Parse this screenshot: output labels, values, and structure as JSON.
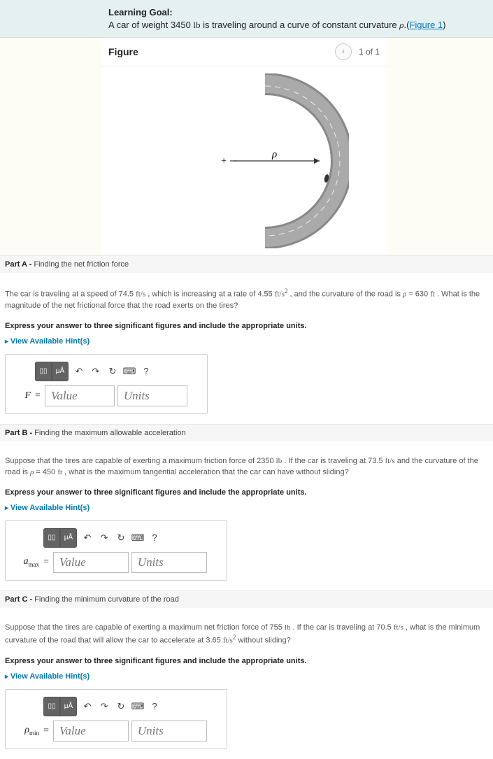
{
  "learning_goal": {
    "title": "Learning Goal:",
    "prefix": "A car of weight 3450 ",
    "unit1": "lb",
    "mid": " is traveling around a curve of constant curvature ",
    "rho": "ρ",
    "paren_open": ".(",
    "figure_link": "Figure 1",
    "paren_close": ")"
  },
  "figure": {
    "title": "Figure",
    "counter": "1 of 1",
    "rho_label": "ρ",
    "plus": "+"
  },
  "instruction": "Express your answer to three significant figures and include the appropriate units.",
  "hints": "View Available Hint(s)",
  "placeholders": {
    "value": "Value",
    "units": "Units"
  },
  "partA": {
    "label": "Part A -",
    "title": " Finding the net friction force",
    "t1": "The car is traveling at a speed of 74.5 ",
    "u1": "ft/s",
    "t2": " , which is increasing at a rate of 4.55 ",
    "u2": "ft/s",
    "sup2": "2",
    "t3": " , and the curvature of the road is ",
    "rho": "ρ",
    "t4": " = 630 ",
    "u3": "ft",
    "t5": " . What is the magnitude of the net frictional force that the road exerts on the tires?",
    "var": "F"
  },
  "partB": {
    "label": "Part B -",
    "title": " Finding the maximum allowable acceleration",
    "t1": "Suppose that the tires are capable of exerting a maximum friction force of 2350 ",
    "u1": "lb",
    "t2": " . If the car is traveling at 73.5 ",
    "u2": "ft/s",
    "t3": " and the curvature of the road is ",
    "rho": "ρ",
    "t4": " = 450 ",
    "u3": "ft",
    "t5": " , what is the maximum tangential acceleration that the car can have without sliding?",
    "var": "a",
    "sub": "max"
  },
  "partC": {
    "label": "Part C -",
    "title": " Finding the minimum curvature of the road",
    "t1": "Suppose that the tires are capable of exerting a maximum net friction force of 755 ",
    "u1": "lb",
    "t2": " . If the car is traveling at 70.5 ",
    "u2": "ft/s",
    "t3": " , what is the minimum curvature of the road that will allow the car to accelerate at 3.65 ",
    "u3": "ft/s",
    "sup2": "2",
    "t4": " without sliding?",
    "var": "ρ",
    "sub": "min"
  },
  "toolbar": {
    "template1": "▯▯",
    "template2": "μÅ",
    "undo": "↶",
    "redo": "↷",
    "reset": "↻",
    "keyboard": "⌨",
    "help": "?"
  }
}
